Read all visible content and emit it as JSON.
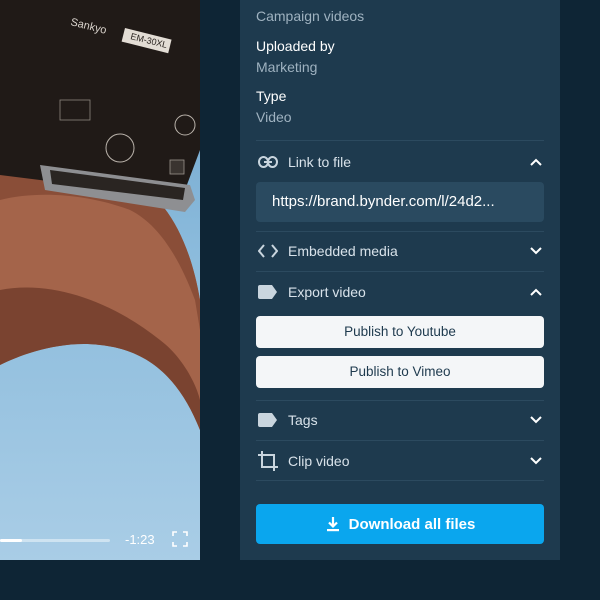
{
  "video": {
    "time_remaining": "-1:23",
    "progress": 0.2,
    "camera_brand": "Sankyo",
    "camera_model": "EM-30XL"
  },
  "metadata": {
    "category_value": "Campaign videos",
    "uploaded_by_label": "Uploaded by",
    "uploaded_by_value": "Marketing",
    "type_label": "Type",
    "type_value": "Video"
  },
  "sections": {
    "link_to_file": {
      "label": "Link to file",
      "url": "https://brand.bynder.com/l/24d2..."
    },
    "embedded_media": {
      "label": "Embedded media"
    },
    "export_video": {
      "label": "Export video",
      "youtube_label": "Publish to Youtube",
      "vimeo_label": "Publish to Vimeo"
    },
    "tags": {
      "label": "Tags"
    },
    "clip_video": {
      "label": "Clip video"
    }
  },
  "download": {
    "label": "Download all files"
  },
  "colors": {
    "background": "#0e2535",
    "panel": "#1e3a4e",
    "accent": "#0aa6ee"
  }
}
